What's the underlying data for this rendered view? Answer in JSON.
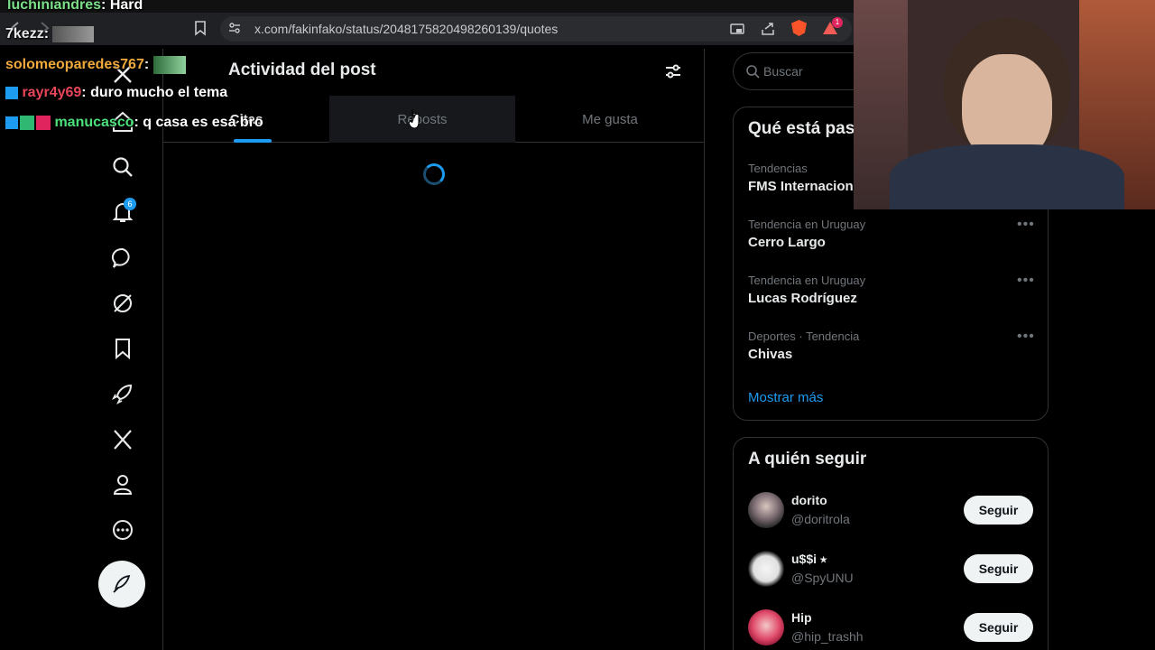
{
  "browser": {
    "url": "x.com/fakinfako/status/2048175820498260139/quotes",
    "notification_count": "1"
  },
  "nav": {
    "notifications_badge": "6",
    "items": [
      "home",
      "explore",
      "notifications",
      "messages",
      "grok",
      "bookmarks",
      "communities",
      "premium",
      "profile",
      "more"
    ]
  },
  "main": {
    "title": "Actividad del post",
    "tabs": [
      {
        "label": "Citas",
        "active": true
      },
      {
        "label": "Reposts",
        "active": false
      },
      {
        "label": "Me gusta",
        "active": false
      }
    ]
  },
  "search": {
    "placeholder": "Buscar"
  },
  "trends": {
    "title": "Qué está pasando",
    "items": [
      {
        "meta": "Tendencias",
        "name": "FMS Internacional"
      },
      {
        "meta": "Tendencia en Uruguay",
        "name": "Cerro Largo"
      },
      {
        "meta": "Tendencia en Uruguay",
        "name": "Lucas Rodríguez"
      },
      {
        "meta": "Deportes · Tendencia",
        "name": "Chivas"
      }
    ],
    "show_more": "Mostrar más"
  },
  "who_to_follow": {
    "title": "A quién seguir",
    "follow_label": "Seguir",
    "users": [
      {
        "name": "dorito",
        "handle": "@doritrola"
      },
      {
        "name": "u$$i ⭑",
        "handle": "@SpyUNU"
      },
      {
        "name": "Hip",
        "handle": "@hip_trashh"
      }
    ]
  },
  "chat": {
    "messages": [
      {
        "user": "luchiniandres",
        "text": "Hard",
        "color": "#7de08a"
      },
      {
        "user": "7kezz",
        "text": "",
        "color": "#e7e9ea"
      },
      {
        "user": "solomeoparedes767",
        "text": "",
        "color": "#f0a93b"
      },
      {
        "user": "rayr4y69",
        "text": "duro mucho el tema",
        "color": "#e8455a"
      },
      {
        "user": "manucasco",
        "text": "q casa es esa bro",
        "color": "#4be07a"
      }
    ]
  },
  "colors": {
    "accent": "#1d9bf0",
    "background": "#000000",
    "border": "#2f3336"
  }
}
